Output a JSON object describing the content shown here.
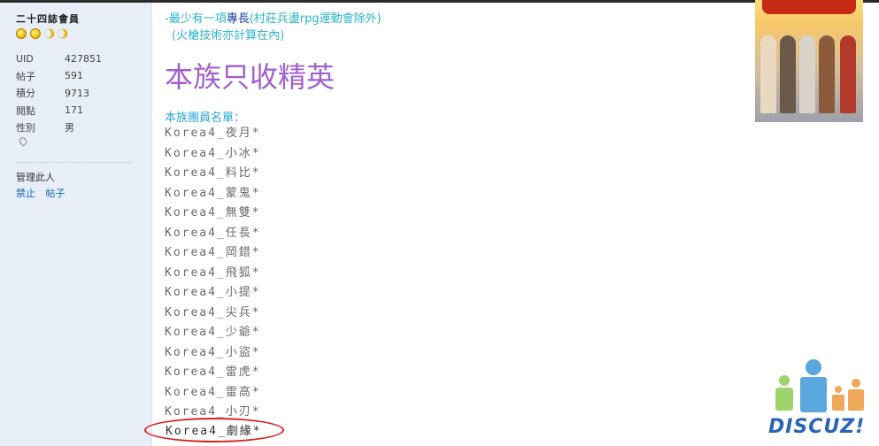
{
  "sidebar": {
    "username": "二十四誌會員",
    "stats": [
      {
        "label": "UID",
        "value": "427851"
      },
      {
        "label": "帖子",
        "value": "591"
      },
      {
        "label": "積分",
        "value": "9713"
      },
      {
        "label": "閱點",
        "value": "171"
      },
      {
        "label": "性別",
        "value": "男"
      }
    ],
    "manage_title": "管理此人",
    "manage_links": [
      "禁止",
      "帖子"
    ]
  },
  "post": {
    "note_line1_prefix": "-最少有一項",
    "note_line1_emph": "專長",
    "note_line1_suffix": "(村莊兵盪rpg運動會除外)",
    "note_line2": "(火槍技術亦計算在內)",
    "heading": "本族只收精英",
    "list_title": "本族團員名單：",
    "members": [
      "Korea4_夜月*",
      "Korea4_小冰*",
      "Korea4_料比*",
      "Korea4_蒙鬼*",
      "Korea4_無雙*",
      "Korea4_任長*",
      "Korea4_岡錯*",
      "Korea4_飛狐*",
      "Korea4_小提*",
      "Korea4_尖兵*",
      "Korea4_少爺*",
      "Korea4_小盜*",
      "Korea4_雷虎*",
      "Korea4_雷高*",
      "Korea4_小刃*"
    ],
    "highlighted_member": "Korea4_劇緣*"
  },
  "watermark": {
    "text": "DISCUZ!"
  },
  "colors": {
    "heading": "#a25fd0",
    "note": "#2ab5c8",
    "list_title": "#2aa6dc",
    "highlight_circle": "#d82020",
    "sidebar_bg": "#e8eef7"
  }
}
